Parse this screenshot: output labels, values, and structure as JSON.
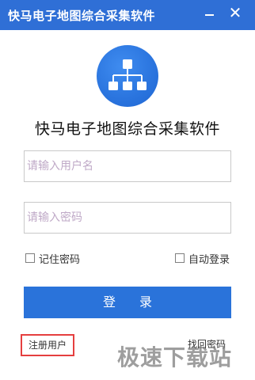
{
  "window": {
    "title": "快马电子地图综合采集软件",
    "minimize_icon": "minimize-icon",
    "close_icon": "close-icon",
    "close_glyph": "✕"
  },
  "app": {
    "logo_icon": "hierarchy-icon",
    "title": "快马电子地图综合采集软件"
  },
  "form": {
    "username_placeholder": "请输入用户名",
    "username_value": "",
    "password_placeholder": "请输入密码",
    "password_value": "",
    "remember_label": "记住密码",
    "remember_checked": false,
    "autologin_label": "自动登录",
    "autologin_checked": false,
    "login_label": "登录"
  },
  "footer": {
    "register_label": "注册用户",
    "forgot_label": "找回密码"
  },
  "watermark": {
    "text": "极速下载站"
  },
  "colors": {
    "titlebar": "#2f6fd6",
    "primary": "#2a73da",
    "highlight_border": "#e53f3f"
  }
}
